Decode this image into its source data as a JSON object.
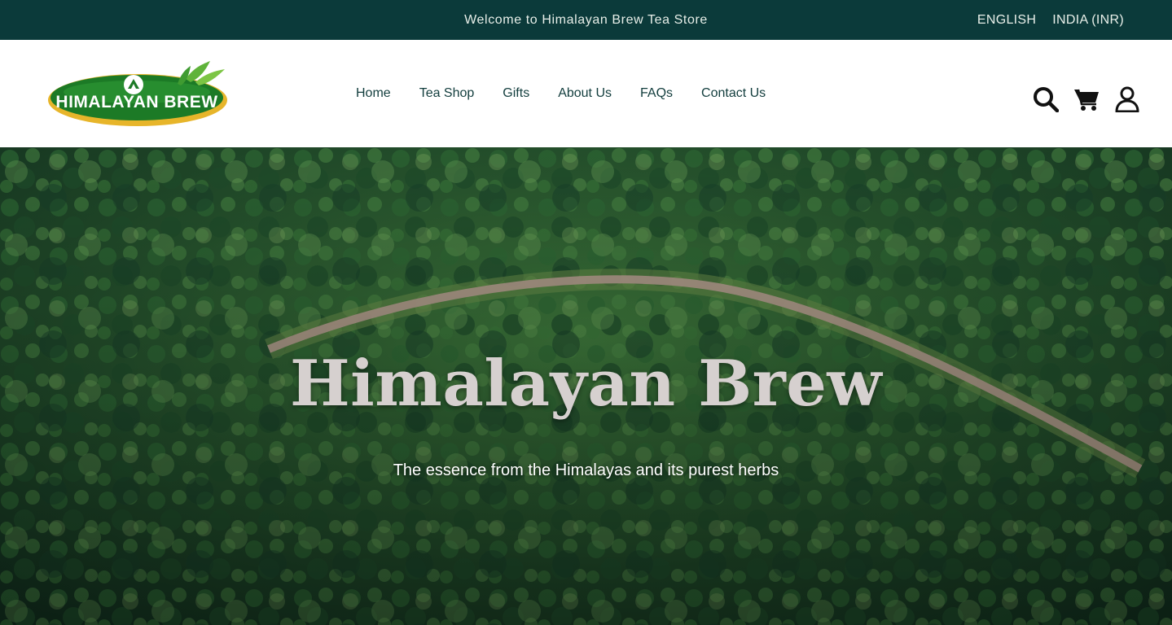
{
  "announcement": {
    "message": "Welcome to Himalayan Brew Tea Store",
    "language": "ENGLISH",
    "region": "INDIA (INR)"
  },
  "header": {
    "logo_text": "HIMALAYAN BREW",
    "nav": [
      {
        "label": "Home"
      },
      {
        "label": "Tea Shop"
      },
      {
        "label": "Gifts"
      },
      {
        "label": "About Us"
      },
      {
        "label": "FAQs"
      },
      {
        "label": "Contact Us"
      }
    ],
    "icons": [
      "search-icon",
      "cart-icon",
      "account-icon"
    ]
  },
  "hero": {
    "title": "Himalayan Brew",
    "subtitle": "The essence from the Himalayas and its purest herbs",
    "background": "aerial-forest-road"
  },
  "colors": {
    "announce_bg": "#0b3a3a",
    "nav_text": "#123d3d",
    "logo_green": "#1f7a2a",
    "logo_gold": "#e7b52a"
  }
}
